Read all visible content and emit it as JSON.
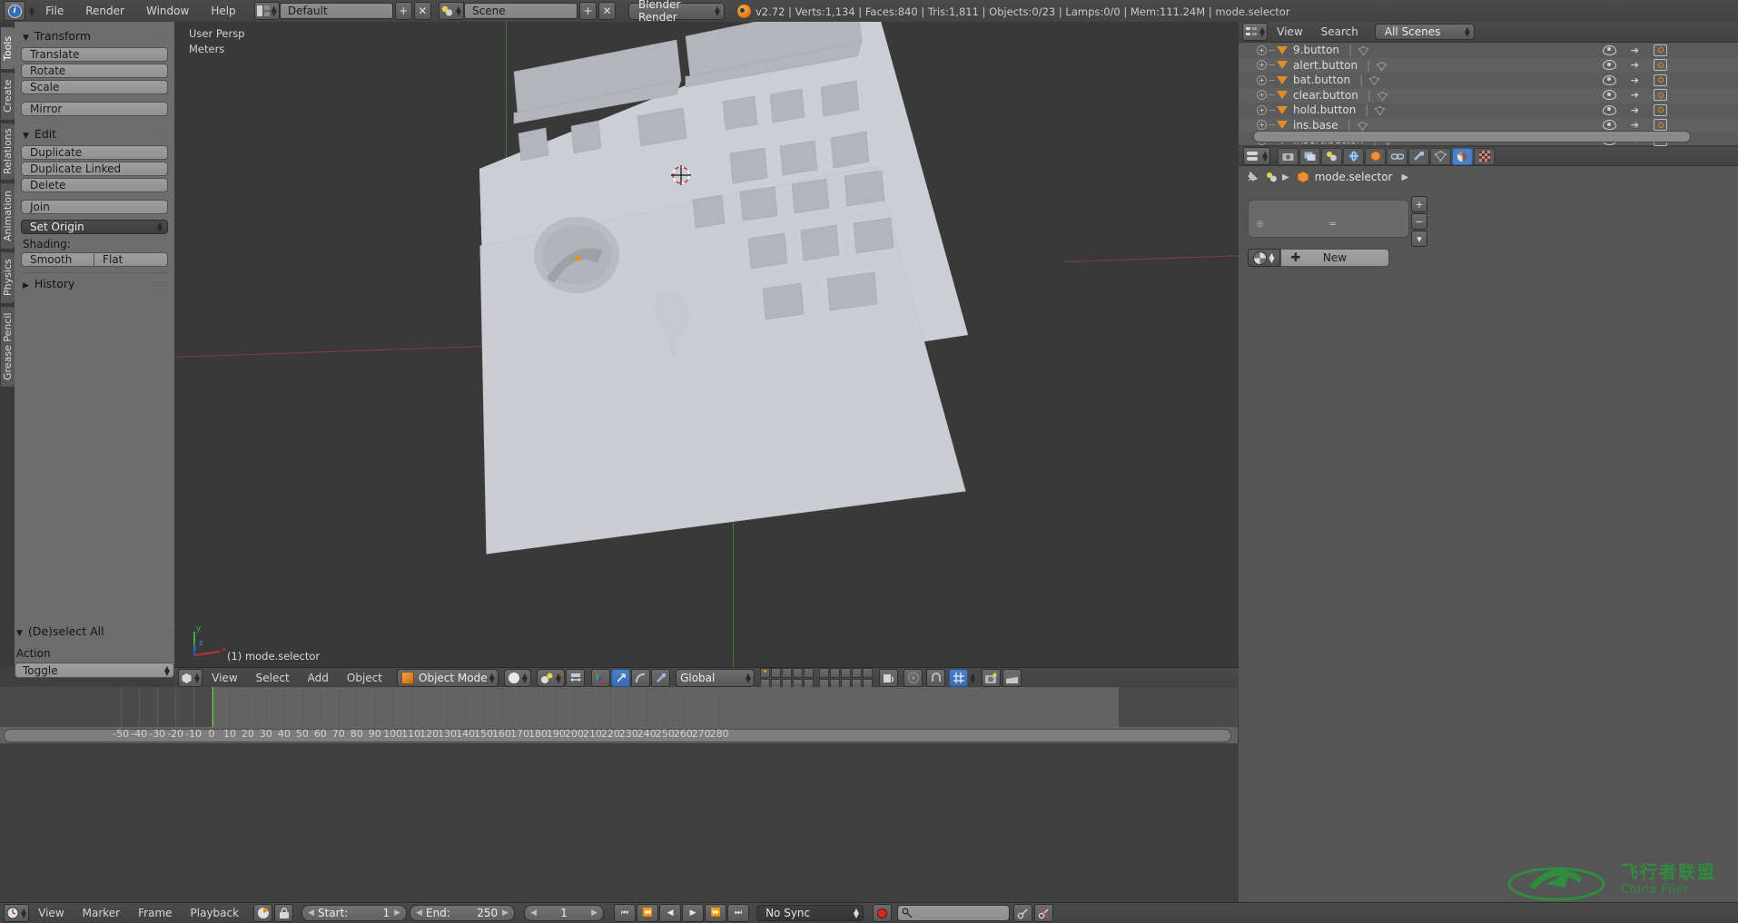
{
  "topbar": {
    "logo_icon": "blender-logo-icon",
    "menus": [
      "File",
      "Render",
      "Window",
      "Help"
    ],
    "screen_layout": {
      "value": "Default",
      "add_label": "+",
      "close_label": "✕"
    },
    "scene": {
      "value": "Scene",
      "add_label": "+",
      "close_label": "✕"
    },
    "render_engine": "Blender Render",
    "stats": "v2.72 | Verts:1,134 | Faces:840 | Tris:1,811 | Objects:0/23 | Lamps:0/0 | Mem:111.24M | mode.selector"
  },
  "toolshelf": {
    "tabs": [
      "Tools",
      "Create",
      "Relations",
      "Animation",
      "Physics",
      "Grease Pencil"
    ],
    "active_tab": "Tools",
    "transform": {
      "title": "Transform",
      "buttons": [
        "Translate",
        "Rotate",
        "Scale",
        "Mirror"
      ]
    },
    "edit": {
      "title": "Edit",
      "buttons": [
        "Duplicate",
        "Duplicate Linked",
        "Delete",
        "Join"
      ],
      "set_origin": "Set Origin",
      "shading_label": "Shading:",
      "shading_buttons": [
        "Smooth",
        "Flat"
      ]
    },
    "history": {
      "title": "History"
    },
    "operator": {
      "title": "(De)select All",
      "action_label": "Action",
      "action_value": "Toggle"
    }
  },
  "viewport": {
    "view_name": "User Persp",
    "unit": "Meters",
    "active_object": "(1) mode.selector",
    "axis_labels": {
      "x": "x",
      "y": "y",
      "z": "z"
    },
    "header": {
      "menus": [
        "View",
        "Select",
        "Add",
        "Object"
      ],
      "mode": "Object Mode",
      "transform_orientation": "Global",
      "icons": [
        "viewport-shading-icon",
        "pivot-point-icon",
        "snap-magnet-icon",
        "manipulator-icon",
        "proportional-edit-icon",
        "render-preview-icon",
        "opengl-render-icon"
      ]
    }
  },
  "timeline": {
    "ticks": [
      -50,
      -40,
      -30,
      -20,
      -10,
      0,
      10,
      20,
      30,
      40,
      50,
      60,
      70,
      80,
      90,
      100,
      110,
      120,
      130,
      140,
      150,
      160,
      170,
      180,
      190,
      200,
      210,
      220,
      230,
      240,
      250,
      260,
      270,
      280
    ],
    "playhead": 1,
    "range_start": 0,
    "range_end": 250,
    "header": {
      "menus": [
        "View",
        "Marker",
        "Frame",
        "Playback"
      ],
      "start_label": "Start:",
      "start_value": "1",
      "end_label": "End:",
      "end_value": "250",
      "current_frame": "1",
      "sync_mode": "No Sync",
      "transport": [
        "jump-start-icon",
        "prev-keyframe-icon",
        "play-reverse-icon",
        "play-icon",
        "next-keyframe-icon",
        "jump-end-icon"
      ],
      "record_icon": "record-button-icon",
      "keying_set_placeholder": ""
    }
  },
  "outliner": {
    "header": {
      "menus": [
        "View",
        "Search"
      ],
      "display_mode": "All Scenes"
    },
    "rows": [
      {
        "name": "9.button"
      },
      {
        "name": "alert.button"
      },
      {
        "name": "bat.button"
      },
      {
        "name": "clear.button"
      },
      {
        "name": "hold.button"
      },
      {
        "name": "ins.base"
      },
      {
        "name": "insert.button"
      }
    ],
    "row_icons": [
      "expand-icon",
      "mesh-object-icon",
      "mesh-data-icon",
      "eye-icon",
      "cursor-select-icon",
      "camera-render-icon"
    ]
  },
  "properties": {
    "tabs": [
      "render-tab-icon",
      "render-layers-tab-icon",
      "scene-tab-icon",
      "world-tab-icon",
      "object-tab-icon",
      "constraints-tab-icon",
      "modifiers-tab-icon",
      "object-data-tab-icon",
      "material-tab-icon",
      "texture-tab-icon"
    ],
    "active_tab": "material-tab-icon",
    "breadcrumb_object": "mode.selector",
    "pin_icon": "pin-icon",
    "material_slot_buttons": [
      "+",
      "−",
      "▾"
    ],
    "new_button": "New"
  },
  "watermark": {
    "cn": "飞行者联盟",
    "en": "China Flier"
  },
  "colors": {
    "accent_blue": "#4b7fc6",
    "orange": "#e08c27",
    "playhead_green": "#5ee53a",
    "panel_bg": "#6d6d6d",
    "viewport_bg": "#393939"
  }
}
